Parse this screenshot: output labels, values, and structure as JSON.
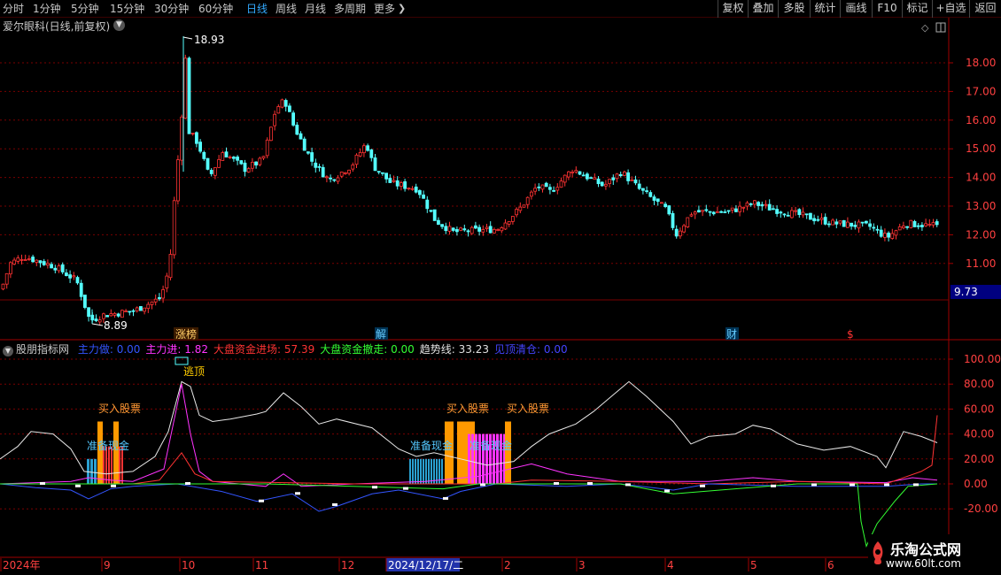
{
  "toolbar": {
    "periods": [
      "分时",
      "1分钟",
      "5分钟",
      "15分钟",
      "30分钟",
      "60分钟",
      "日线",
      "周线",
      "月线",
      "多周期",
      "更多"
    ],
    "active_period": "日线",
    "right_buttons": [
      "复权",
      "叠加",
      "多股",
      "统计",
      "画线",
      "F10",
      "标记",
      "+自选",
      "返回"
    ]
  },
  "stock": {
    "title": "爱尔眼科(日线,前复权)"
  },
  "price_axis": {
    "ticks": [
      "18.00",
      "17.00",
      "16.00",
      "15.00",
      "14.00",
      "13.00",
      "12.00",
      "11.00"
    ],
    "current_price": "9.73"
  },
  "annotations": {
    "high_label": "18.93",
    "low_label": "8.89",
    "event_labels": [
      "涨榜",
      "解",
      "财",
      "$"
    ],
    "signal_labels": [
      "逃顶",
      "买入股票",
      "买入股票",
      "买入股票",
      "准备现金",
      "准备现金",
      "准备现金"
    ]
  },
  "indicator": {
    "name": "股朋指标网",
    "fields": [
      {
        "label": "主力做:",
        "value": "0.00",
        "color": "#3355ff"
      },
      {
        "label": "主力进:",
        "value": "1.82",
        "color": "#ff33ff"
      },
      {
        "label": "大盘资金进场:",
        "value": "57.39",
        "color": "#ff3333"
      },
      {
        "label": "大盘资金撤走:",
        "value": "0.00",
        "color": "#33ff33"
      },
      {
        "label": "趋势线:",
        "value": "33.23",
        "color": "#e0e0e0"
      },
      {
        "label": "见顶清仓:",
        "value": "0.00",
        "color": "#4444ff"
      }
    ],
    "axis_ticks": [
      "100.00",
      "80.00",
      "60.00",
      "40.00",
      "20.00",
      "0.00",
      "-20.00"
    ]
  },
  "date_axis": {
    "labels": [
      "2024年",
      "9",
      "10",
      "11",
      "12",
      "2024/12/17/二",
      "2",
      "3",
      "4",
      "5",
      "6"
    ]
  },
  "watermark": {
    "title": "乐淘公式网",
    "url": "www.60lt.com"
  },
  "colors": {
    "up": "#ff3333",
    "down": "#54ffff",
    "grid": "#7a0000",
    "trend": "#e8e8e8",
    "bar_cyan": "#2aa0d0",
    "bar_orange": "#ff9900",
    "bar_magenta": "#ff33ff"
  }
}
